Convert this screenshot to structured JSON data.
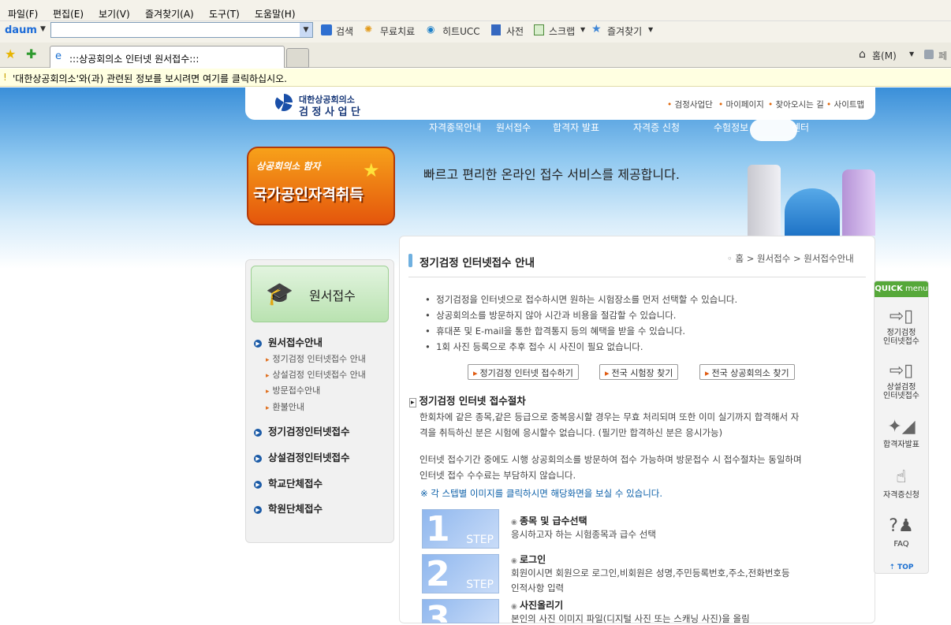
{
  "browser": {
    "menu": [
      "파일(F)",
      "편집(E)",
      "보기(V)",
      "즐겨찾기(A)",
      "도구(T)",
      "도움말(H)"
    ],
    "toolbar": {
      "logo": "daum",
      "search": "검색",
      "free": "무료치료",
      "ucc": "히트UCC",
      "dict": "사전",
      "scrap": "스크랩",
      "fav": "즐겨찾기"
    },
    "tab_title": ":::상공회의소 인터넷 원서접수:::",
    "home": "홈(M)",
    "cut": "페",
    "infobar": "'대한상공회의소'와(과) 관련된 정보를 보시려면 여기를 클릭하십시오."
  },
  "site": {
    "logo_line1": "대한상공회의소",
    "logo_line2": "검 정 사 업 단",
    "toplinks": [
      "검정사업단",
      "마이페이지",
      "찾아오시는 길",
      "사이트맵"
    ],
    "nav": [
      "자격종목안내",
      "원서접수",
      "합격자  발표",
      "자격증 신청",
      "수험정보",
      "센터"
    ],
    "banner_small": "상공회의소 함자",
    "banner_big": "국가공인자격취득",
    "tagline": "빠르고 편리한 온라인 접수 서비스를 제공합니다."
  },
  "left": {
    "title": "원서접수",
    "menu": [
      "원서접수안내",
      "정기검정인터넷접수",
      "상설검정인터넷접수",
      "학교단체접수",
      "학원단체접수"
    ],
    "sub": [
      "정기검정 인터넷접수 안내",
      "상설검정 인터넷접수 안내",
      "방문접수안내",
      "환불안내"
    ]
  },
  "main": {
    "title": "정기검정 인터넷접수 안내",
    "breadcrumb": "홈 > 원서접수 > 원서접수안내",
    "bullets": [
      "정기검정을 인터넷으로 접수하시면 원하는 시험장소를 먼저 선택할 수 있습니다.",
      "상공회의소를 방문하지 않아 시간과 비용을 절감할 수 있습니다.",
      "휴대폰 및 E-mail을 통한 합격통지 등의 혜택을 받을 수 있습니다.",
      "1회 사진 등록으로 추후 접수 시 사진이 필요 없습니다."
    ],
    "buttons": [
      "정기검정 인터넷 접수하기",
      "전국 시험장 찾기",
      "전국 상공회의소 찾기"
    ],
    "proc_title": "정기검정 인터넷 접수절차",
    "para1a": "한회차에 같은 종목,같은 등급으로 중복응시할 경우는 무효 처리되며 또한 이미 실기까지 합격해서 자",
    "para1b": "격을 취득하신 분은 시험에 응시할수 없습니다. (필기만 합격하신 분은 응시가능)",
    "para2a": "인터넷 접수기간 중에도 시행 상공회의소를 방문하여 접수 가능하며 방문접수 시 접수절차는 동일하며",
    "para2b": "인터넷 접수 수수료는 부담하지 않습니다.",
    "note": "※ 각 스텝별 이미지를 클릭하시면 해당화면을 보실 수 있습니다.",
    "step_label": "STEP",
    "steps": [
      {
        "num": "1",
        "title": "종목 및 급수선택",
        "desc": "응시하고자 하는 시험종목과 급수 선택",
        "desc2": ""
      },
      {
        "num": "2",
        "title": "로그인",
        "desc": "회원이시면 회원으로 로그인,비회원은 성명,주민등록번호,주소,전화번호등",
        "desc2": "인적사항 입력"
      },
      {
        "num": "3",
        "title": "사진올리기",
        "desc": "본인의 사진 이미지 파일(디지털 사진 또는 스캐닝 사진)을 올림",
        "desc2": ""
      }
    ]
  },
  "quick": {
    "head": "QUICK",
    "head2": "menu",
    "items": [
      "정기검정\n인터넷접수",
      "상설검정\n인터넷접수",
      "합격자발표",
      "자격증신청",
      "FAQ"
    ],
    "top": "TOP"
  }
}
